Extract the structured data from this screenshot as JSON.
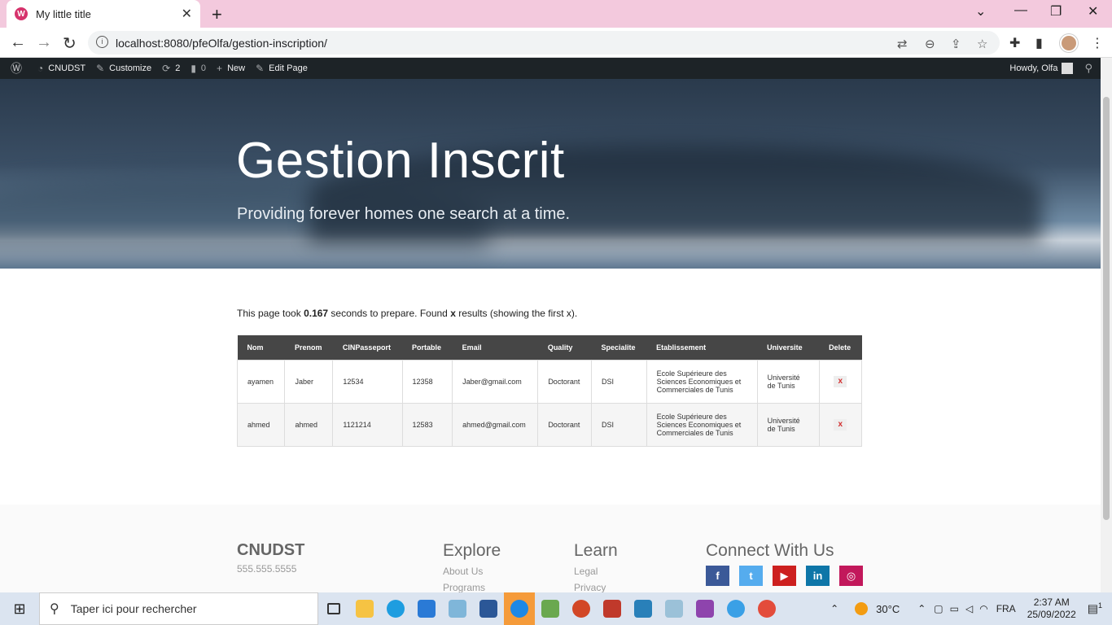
{
  "browser": {
    "tab_title": "My little title",
    "tab_favicon": "W",
    "url": "localhost:8080/pfeOlfa/gestion-inscription/",
    "info_icon": "i"
  },
  "wp_admin_bar": {
    "site_name": "CNUDST",
    "customize": "Customize",
    "updates_count": "2",
    "comments_count": "0",
    "new": "New",
    "edit_page": "Edit Page",
    "howdy": "Howdy, Olfa"
  },
  "hero": {
    "title": "Gestion Inscrit",
    "subtitle": "Providing forever homes one search at a time."
  },
  "notice": {
    "prefix": "This page took ",
    "seconds": "0.167",
    "middle": " seconds to prepare. Found ",
    "count": "x",
    "suffix": " results (showing the first x)."
  },
  "table": {
    "headers": [
      "Nom",
      "Prenom",
      "CINPasseport",
      "Portable",
      "Email",
      "Quality",
      "Specialite",
      "Etablissement",
      "Universite",
      "Delete"
    ],
    "rows": [
      [
        "ayamen",
        "Jaber",
        "12534",
        "12358",
        "Jaber@gmail.com",
        "Doctorant",
        "DSI",
        "Ecole Supérieure des Sciences Economiques et Commerciales de Tunis",
        "Université de Tunis",
        "x"
      ],
      [
        "ahmed",
        "ahmed",
        "1121214",
        "12583",
        "ahmed@gmail.com",
        "Doctorant",
        "DSI",
        "Ecole Supérieure des Sciences Economiques et Commerciales de Tunis",
        "Université de Tunis",
        "x"
      ]
    ]
  },
  "footer": {
    "brand": "CNUDST",
    "phone": "555.555.5555",
    "explore_title": "Explore",
    "explore_links": [
      "About Us",
      "Programs"
    ],
    "learn_title": "Learn",
    "learn_links": [
      "Legal",
      "Privacy"
    ],
    "connect_title": "Connect With Us",
    "social": [
      {
        "name": "facebook-icon",
        "glyph": "f",
        "color": "#3b5998"
      },
      {
        "name": "twitter-icon",
        "glyph": "t",
        "color": "#55acee"
      },
      {
        "name": "youtube-icon",
        "glyph": "▶",
        "color": "#cd201f"
      },
      {
        "name": "linkedin-icon",
        "glyph": "in",
        "color": "#0e76a8"
      },
      {
        "name": "instagram-icon",
        "glyph": "◎",
        "color": "#c2185b"
      }
    ]
  },
  "taskbar": {
    "search_placeholder": "Taper ici pour rechercher",
    "weather": "30°C",
    "language": "FRA",
    "time": "2:37 AM",
    "date": "25/09/2022",
    "notifications": "1"
  }
}
